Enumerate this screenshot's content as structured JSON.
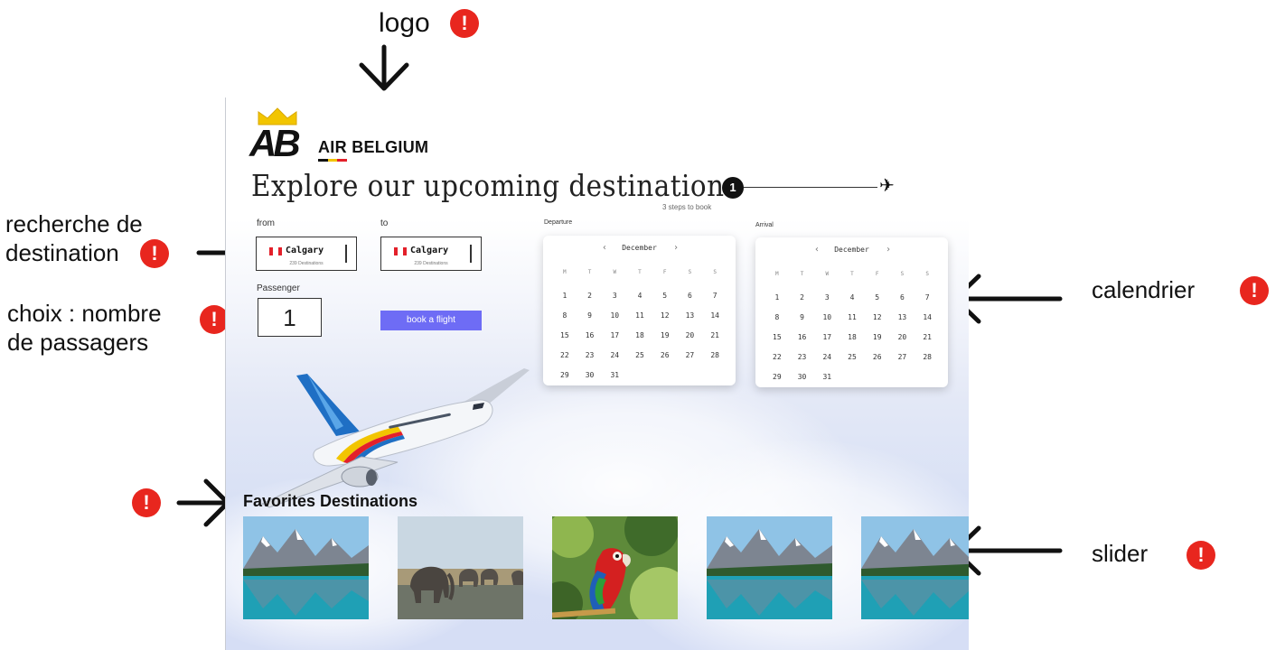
{
  "annotations": {
    "logo": "logo",
    "search": "recherche de\ndestination",
    "passengers": "choix : nombre\nde passagers",
    "calendar": "calendrier",
    "favorites_mark": "",
    "slider": "slider",
    "alert_glyph": "!"
  },
  "brand": {
    "logo_letters": "AB",
    "name": "AIR BELGIUM",
    "flag_colors": [
      "#111111",
      "#f2c500",
      "#e3202a"
    ]
  },
  "headline": "Explore our upcoming destinations",
  "steps": {
    "current": "1",
    "caption": "3 steps to book"
  },
  "search": {
    "from_label": "from",
    "to_label": "to",
    "from": {
      "city": "Calgary",
      "sub": "239 Destinations"
    },
    "to": {
      "city": "Calgary",
      "sub": "239 Destinations"
    },
    "passenger_label": "Passenger",
    "passenger_value": "1",
    "book_button": "book a flight"
  },
  "departure": {
    "label": "Departure",
    "month": "December",
    "prev": "‹",
    "next": "›",
    "weekdays": [
      "M",
      "T",
      "W",
      "T",
      "F",
      "S",
      "S"
    ],
    "days": [
      "1",
      "2",
      "3",
      "4",
      "5",
      "6",
      "7",
      "8",
      "9",
      "10",
      "11",
      "12",
      "13",
      "14",
      "15",
      "16",
      "17",
      "18",
      "19",
      "20",
      "21",
      "22",
      "23",
      "24",
      "25",
      "26",
      "27",
      "28",
      "29",
      "30",
      "31"
    ]
  },
  "arrival": {
    "label": "Arrival",
    "month": "December",
    "prev": "‹",
    "next": "›",
    "weekdays": [
      "M",
      "T",
      "W",
      "T",
      "F",
      "S",
      "S"
    ],
    "days": [
      "1",
      "2",
      "3",
      "4",
      "5",
      "6",
      "7",
      "8",
      "9",
      "10",
      "11",
      "12",
      "13",
      "14",
      "15",
      "16",
      "17",
      "18",
      "19",
      "20",
      "21",
      "22",
      "23",
      "24",
      "25",
      "26",
      "27",
      "28",
      "29",
      "30",
      "31"
    ]
  },
  "favorites": {
    "title": "Favorites Destinations",
    "items": [
      {
        "scene": "mountain-lake"
      },
      {
        "scene": "elephants"
      },
      {
        "scene": "parrot"
      },
      {
        "scene": "mountain-lake"
      },
      {
        "scene": "mountain-lake"
      }
    ]
  },
  "colors": {
    "accent_button": "#6e6cf5",
    "alert": "#e8261e",
    "canada_red": "#e3202a"
  }
}
